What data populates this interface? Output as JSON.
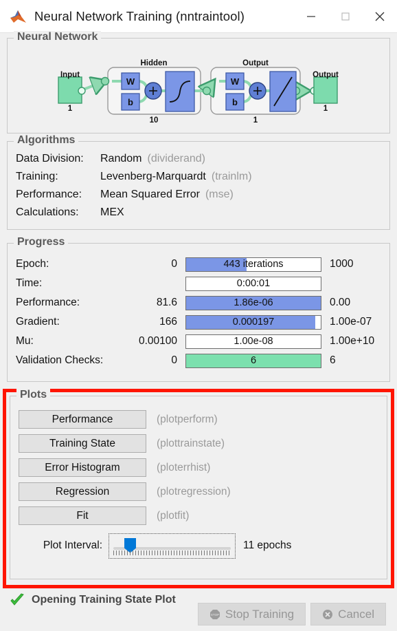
{
  "window": {
    "title": "Neural Network Training (nntraintool)",
    "logo_icon": "matlab-logo-icon",
    "minimize_icon": "minimize-icon",
    "maximize_icon": "maximize-icon",
    "close_icon": "close-icon"
  },
  "neural_network": {
    "title": "Neural Network",
    "input_label": "Input",
    "input_count": "1",
    "hidden_label": "Hidden",
    "hidden_count": "10",
    "hidden_weight": "W",
    "hidden_bias": "b",
    "output_layer_label": "Output",
    "output_layer_count": "1",
    "output_weight": "W",
    "output_bias": "b",
    "output_label": "Output",
    "output_count": "1",
    "hidden_transfer": "sigmoid",
    "output_transfer": "linear"
  },
  "algorithms": {
    "title": "Algorithms",
    "rows": [
      {
        "key": "Data Division:",
        "value": "Random",
        "fn": "(dividerand)"
      },
      {
        "key": "Training:",
        "value": "Levenberg-Marquardt",
        "fn": "(trainlm)"
      },
      {
        "key": "Performance:",
        "value": "Mean Squared Error",
        "fn": "(mse)"
      },
      {
        "key": "Calculations:",
        "value": "MEX",
        "fn": ""
      }
    ]
  },
  "progress": {
    "title": "Progress",
    "rows": [
      {
        "name": "Epoch:",
        "min": "0",
        "value": "443 iterations",
        "max": "1000",
        "fill_pct": 45,
        "color": "#7b96e6"
      },
      {
        "name": "Time:",
        "min": "",
        "value": "0:00:01",
        "max": "",
        "fill_pct": 0,
        "color": "#7b96e6"
      },
      {
        "name": "Performance:",
        "min": "81.6",
        "value": "1.86e-06",
        "max": "0.00",
        "fill_pct": 100,
        "color": "#7b96e6"
      },
      {
        "name": "Gradient:",
        "min": "166",
        "value": "0.000197",
        "max": "1.00e-07",
        "fill_pct": 96,
        "color": "#7b96e6"
      },
      {
        "name": "Mu:",
        "min": "0.00100",
        "value": "1.00e-08",
        "max": "1.00e+10",
        "fill_pct": 0,
        "color": "#7b96e6"
      },
      {
        "name": "Validation Checks:",
        "min": "0",
        "value": "6",
        "max": "6",
        "fill_pct": 100,
        "color": "#7ce0ae"
      }
    ]
  },
  "plots": {
    "title": "Plots",
    "buttons": [
      {
        "label": "Performance",
        "fn": "(plotperform)"
      },
      {
        "label": "Training State",
        "fn": "(plottrainstate)"
      },
      {
        "label": "Error Histogram",
        "fn": "(ploterrhist)"
      },
      {
        "label": "Regression",
        "fn": "(plotregression)"
      },
      {
        "label": "Fit",
        "fn": "(plotfit)"
      }
    ],
    "interval_label": "Plot Interval:",
    "interval_value": "11 epochs",
    "highlight_color": "#ff1500"
  },
  "status": {
    "icon": "green-check-icon",
    "text": "Opening Training State Plot"
  },
  "footer": {
    "stop_label": "Stop Training",
    "stop_icon": "stop-sign-icon",
    "cancel_label": "Cancel",
    "cancel_icon": "cancel-circle-icon"
  }
}
